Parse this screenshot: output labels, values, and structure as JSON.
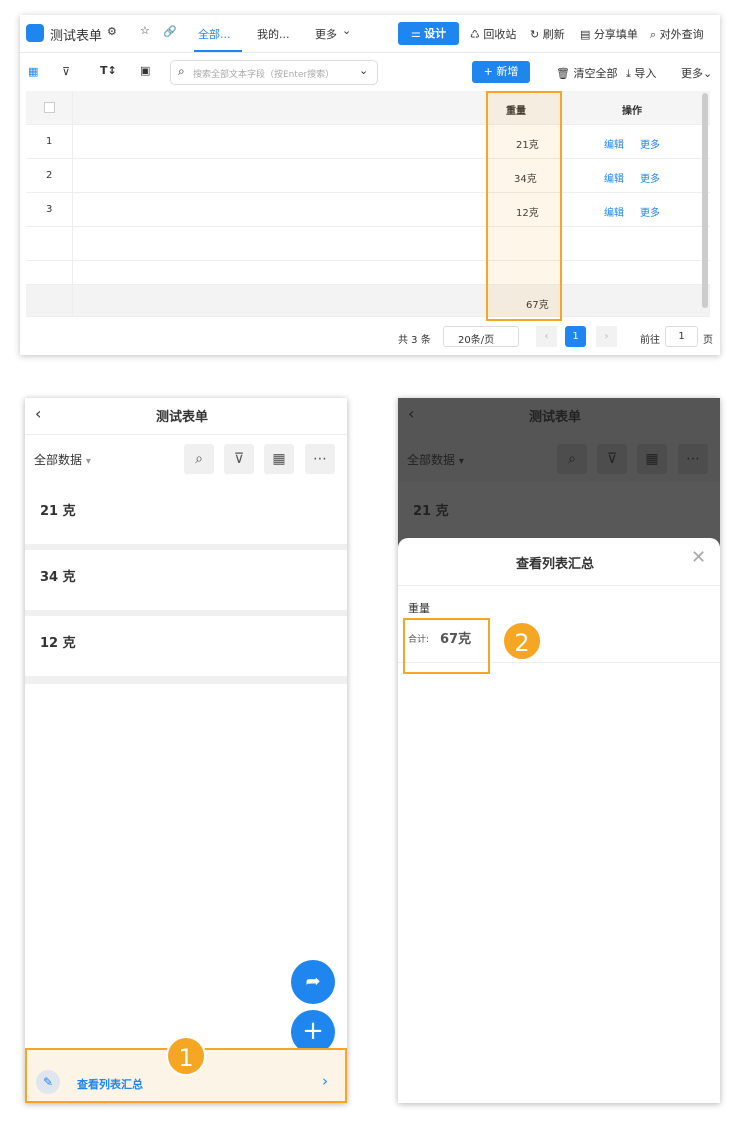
{
  "desktop": {
    "title": "测试表单",
    "tabs": [
      {
        "label": "全部...",
        "active": true
      },
      {
        "label": "我的..."
      },
      {
        "label": "更多"
      }
    ],
    "design_button": "设计",
    "actions": [
      "回收站",
      "刷新",
      "分享填单",
      "对外查询"
    ],
    "search_placeholder": "搜索全部文本字段（按Enter搜索）",
    "add_button": "新增",
    "clear_all": "清空全部",
    "import": "导入",
    "more": "更多",
    "columns": {
      "weight": "重量",
      "actions": "操作"
    },
    "rows": [
      {
        "index": "1",
        "weight": "21克",
        "edit": "编辑",
        "more": "更多"
      },
      {
        "index": "2",
        "weight": "34克",
        "edit": "编辑",
        "more": "更多"
      },
      {
        "index": "3",
        "weight": "12克",
        "edit": "编辑",
        "more": "更多"
      }
    ],
    "summary": "67克",
    "pagination": {
      "total": "共 3 条",
      "page_size": "20条/页",
      "current_page": "1",
      "goto_label": "前往",
      "goto_value": "1",
      "page_suffix": "页"
    }
  },
  "mobile_left": {
    "title": "测试表单",
    "filter": "全部数据",
    "items": [
      "21 克",
      "34 克",
      "12 克"
    ],
    "summary_link": "查看列表汇总",
    "step": "1"
  },
  "mobile_right": {
    "title": "测试表单",
    "filter": "全部数据",
    "item": "21 克",
    "sheet_title": "查看列表汇总",
    "field": "重量",
    "total_label": "合计:",
    "total_value": "67克",
    "step": "2"
  },
  "colors": {
    "accent": "#1f86f0",
    "highlight": "#f5a623"
  }
}
